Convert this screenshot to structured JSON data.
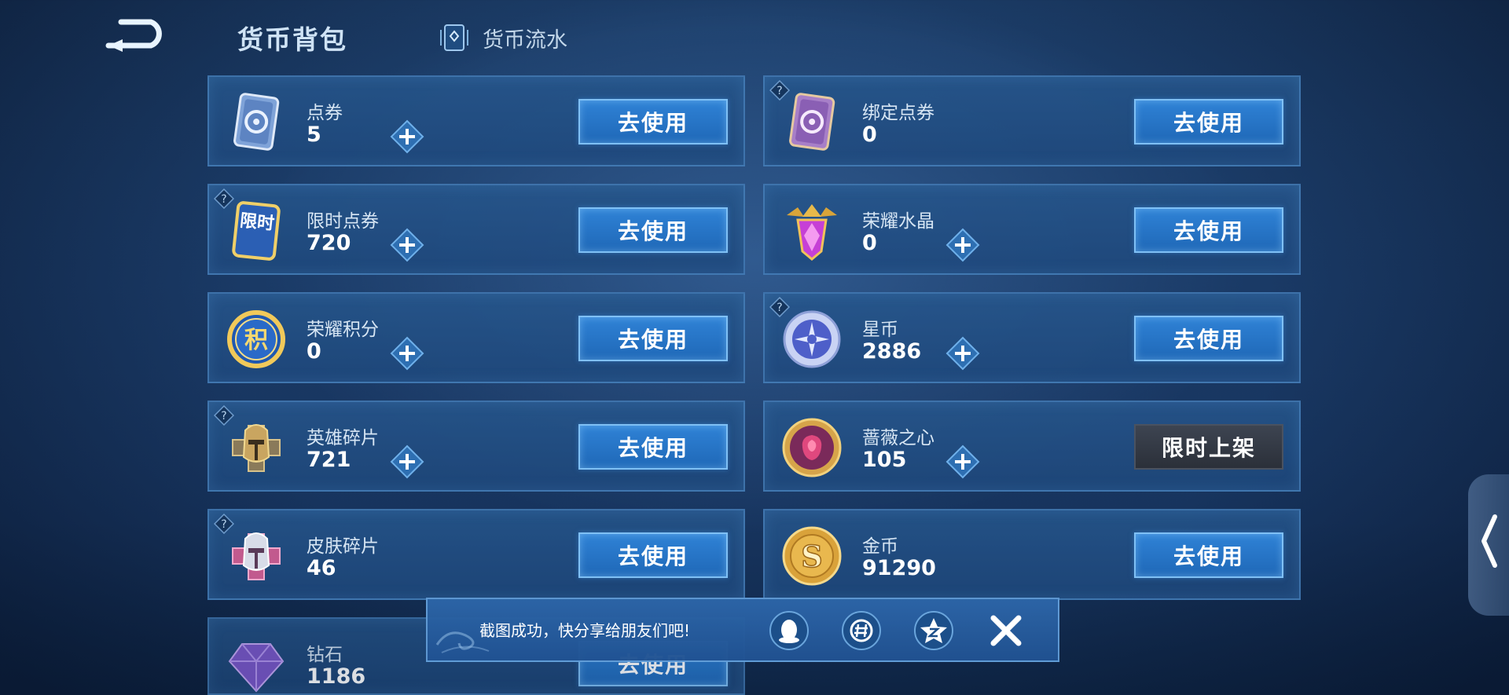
{
  "header": {
    "title": "货币背包",
    "flow_tab_label": "货币流水"
  },
  "currencies": [
    {
      "name": "点券",
      "amount": "5",
      "button": "去使用"
    },
    {
      "name": "绑定点券",
      "amount": "0",
      "button": "去使用"
    },
    {
      "name": "限时点券",
      "amount": "720",
      "button": "去使用",
      "icon_text": "限时"
    },
    {
      "name": "荣耀水晶",
      "amount": "0",
      "button": "去使用"
    },
    {
      "name": "荣耀积分",
      "amount": "0",
      "button": "去使用",
      "icon_text": "积"
    },
    {
      "name": "星币",
      "amount": "2886",
      "button": "去使用"
    },
    {
      "name": "英雄碎片",
      "amount": "721",
      "button": "去使用"
    },
    {
      "name": "蔷薇之心",
      "amount": "105",
      "button": "限时上架"
    },
    {
      "name": "皮肤碎片",
      "amount": "46",
      "button": "去使用"
    },
    {
      "name": "金币",
      "amount": "91290",
      "button": "去使用",
      "icon_text": "S"
    },
    {
      "name": "钻石",
      "amount": "1186",
      "button": "去使用"
    }
  ],
  "toast": {
    "message": "截图成功，快分享给朋友们吧!"
  },
  "icons": {
    "back": "back-arrow-icon",
    "flow": "currency-flow-icon",
    "help": "question-mark-icon",
    "plus": "plus-icon",
    "share_qq": "qq-icon",
    "share_wechat": "wechat-moments-icon",
    "share_qzone": "qzone-icon",
    "close": "close-icon",
    "side_tab": "chevron-left-icon"
  },
  "colors": {
    "accent_button": "#2f82d6",
    "disabled_button": "#3d4451",
    "background": "#1a3a66"
  }
}
